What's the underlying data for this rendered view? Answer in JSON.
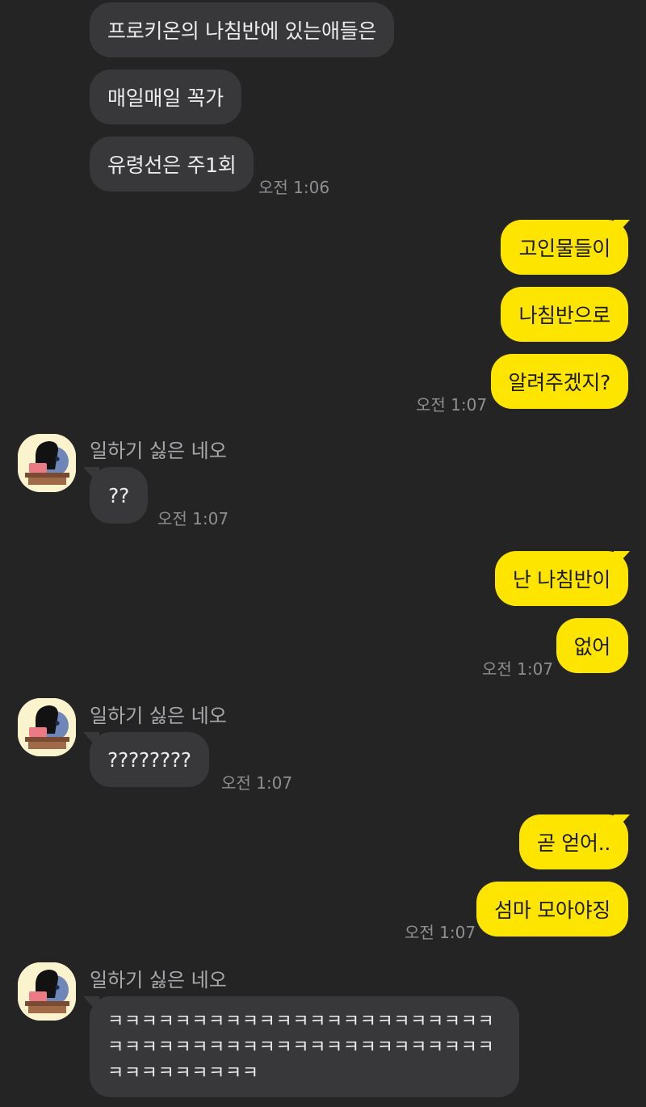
{
  "sender_name": "일하기 싫은 네오",
  "avatar_icon": "neo-character-avatar-icon",
  "colors": {
    "background": "#242425",
    "incoming_bubble": "#38383a",
    "outgoing_bubble": "#fee500",
    "timestamp": "#8f8f92"
  },
  "messages": [
    {
      "direction": "incoming",
      "text": "프로키온의 나침반에 있는애들은"
    },
    {
      "direction": "incoming",
      "text": "매일매일 꼭가"
    },
    {
      "direction": "incoming",
      "text": "유령선은 주1회",
      "time": "오전 1:06"
    },
    {
      "direction": "outgoing",
      "text": "고인물들이"
    },
    {
      "direction": "outgoing",
      "text": "나침반으로"
    },
    {
      "direction": "outgoing",
      "text": "알려주겠지?",
      "time": "오전 1:07"
    },
    {
      "direction": "incoming",
      "text": "??",
      "time": "오전 1:07"
    },
    {
      "direction": "outgoing",
      "text": "난 나침반이"
    },
    {
      "direction": "outgoing",
      "text": "없어",
      "time": "오전 1:07"
    },
    {
      "direction": "incoming",
      "text": "????????",
      "time": "오전 1:07"
    },
    {
      "direction": "outgoing",
      "text": "곧 얻어.."
    },
    {
      "direction": "outgoing",
      "text": "섬마 모아야징",
      "time": "오전 1:07"
    },
    {
      "direction": "incoming",
      "text": "ㅋㅋㅋㅋㅋㅋㅋㅋㅋㅋㅋㅋㅋㅋㅋㅋㅋㅋㅋㅋㅋㅋㅋㅋㅋㅋㅋㅋㅋㅋㅋㅋㅋㅋㅋㅋㅋㅋㅋㅋㅋㅋㅋㅋㅋㅋㅋㅋㅋㅋㅋㅋㅋㅋㅋ"
    }
  ]
}
